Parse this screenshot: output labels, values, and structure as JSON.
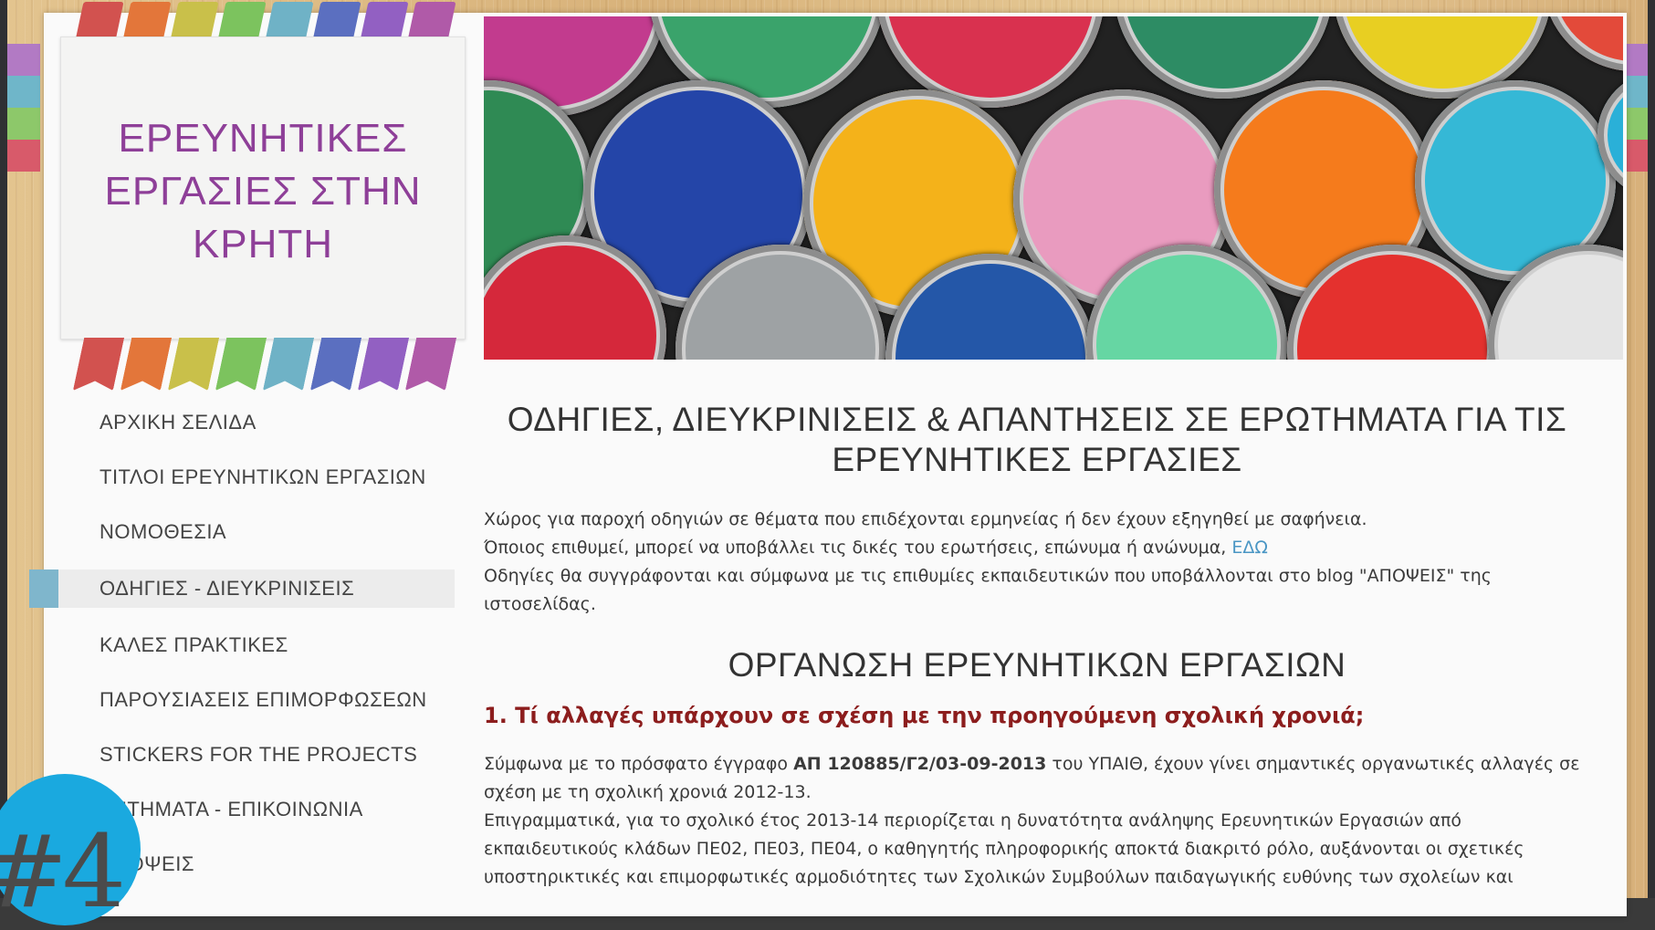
{
  "site": {
    "title_lines": [
      "ΕΡΕΥΝΗΤΙΚΕΣ",
      "ΕΡΓΑΣΙΕΣ ΣΤΗΝ",
      "ΚΡΗΤΗ"
    ]
  },
  "nav": {
    "items": [
      {
        "label": "ΑΡΧΙΚΗ ΣΕΛΙΔΑ",
        "active": false
      },
      {
        "label": "ΤΙΤΛΟΙ ΕΡΕΥΝΗΤΙΚΩΝ ΕΡΓΑΣΙΩΝ",
        "active": false
      },
      {
        "label": "ΝΟΜΟΘΕΣΙΑ",
        "active": false
      },
      {
        "label": "ΟΔΗΓΙΕΣ - ΔΙΕΥΚΡΙΝΙΣΕΙΣ",
        "active": true
      },
      {
        "label": "ΚΑΛΕΣ ΠΡΑΚΤΙΚΕΣ",
        "active": false
      },
      {
        "label": "ΠΑΡΟΥΣΙΑΣΕΙΣ ΕΠΙΜΟΡΦΩΣΕΩΝ",
        "active": false
      },
      {
        "label": "STICKERS FOR THE PROJECTS",
        "active": false
      },
      {
        "label": "ΖΗΤΗΜΑΤΑ - ΕΠΙΚΟΙΝΩΝΙΑ",
        "active": false
      },
      {
        "label": "ΑΠΟΨΕΙΣ",
        "active": false
      }
    ]
  },
  "content": {
    "heading": "ΟΔΗΓΙΕΣ, ΔΙΕΥΚΡΙΝΙΣΕΙΣ & ΑΠΑΝΤΗΣΕΙΣ ΣΕ ΕΡΩΤΗΜΑΤΑ ΓΙΑ ΤΙΣ ΕΡΕΥΝΗΤΙΚΕΣ ΕΡΓΑΣΙΕΣ",
    "intro_line1": "Χώρος για παροχή οδηγιών σε θέματα που επιδέχονται ερμηνείας ή δεν έχουν εξηγηθεί με σαφήνεια.",
    "intro_line2_text": "Όποιος επιθυμεί, μπορεί να υποβάλλει τις δικές του ερωτήσεις, επώνυμα ή ανώνυμα,",
    "intro_link": "ΕΔΩ",
    "intro_line3": "Οδηγίες θα συγγράφονται και σύμφωνα με τις επιθυμίες εκπαιδευτικών που υποβάλλονται στο blog \"ΑΠΟΨΕΙΣ\" της ιστοσελίδας.",
    "section_heading": "ΟΡΓΑΝΩΣΗ ΕΡΕΥΝΗΤΙΚΩΝ ΕΡΓΑΣΙΩΝ",
    "question1": "1. Τί αλλαγές υπάρχουν σε σχέση με την προηγούμενη σχολική χρονιά;",
    "answer_prefix": "Σύμφωνα με το πρόσφατο έγγραφο",
    "answer_doc": "ΑΠ 120885/Γ2/03-09-2013",
    "answer_suffix": "του ΥΠΑΙΘ, έχουν γίνει σημαντικές οργανωτικές αλλαγές σε σχέση με τη σχολική χρονιά 2012-13.",
    "answer_para2": "Επιγραμματικά, για το σχολικό έτος 2013-14 περιορίζεται η δυνατότητα ανάληψης Ερευνητικών Εργασιών από εκπαιδευτικούς κλάδων ΠΕ02, ΠΕ03, ΠΕ04, ο καθηγητής πληροφορικής αποκτά διακριτό ρόλο, αυξάνονται οι σχετικές υποστηρικτικές και επιμορφωτικές αρμοδιότητες των Σχολικών Συμβούλων παιδαγωγικής ευθύνης των σχολείων και"
  },
  "badge": {
    "label": "#4"
  },
  "colors": {
    "title": "#8e3f98",
    "question": "#8c1d1d",
    "link": "#4a96c4",
    "active_marker": "#7fb6cc",
    "badge": "#1aa9df",
    "ribbon": [
      "#d2524f",
      "#e3763a",
      "#c9c04a",
      "#7cc35e",
      "#6fb2c6",
      "#5b6fc0",
      "#9260c2",
      "#b05aa8"
    ]
  },
  "hero": {
    "icon": "colored-chalk-pastels-image"
  }
}
